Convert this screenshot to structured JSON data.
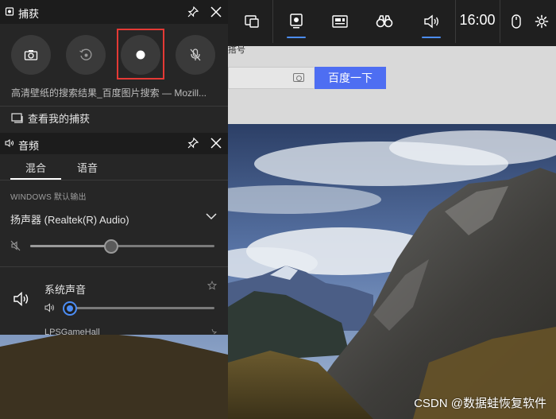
{
  "background": {
    "label_partial": "搭号",
    "search_button": "百度一下",
    "colors": {
      "search_button": "#4e6ef2"
    }
  },
  "gamebar": {
    "clock": "16:00",
    "buttons": [
      {
        "name": "widget-menu",
        "icon": "widget-menu-icon"
      },
      {
        "name": "capture",
        "icon": "capture-icon",
        "active": true
      },
      {
        "name": "performance",
        "icon": "performance-icon"
      },
      {
        "name": "xbox-social",
        "icon": "binoculars-icon"
      },
      {
        "name": "audio",
        "icon": "speaker-icon",
        "active": true
      }
    ],
    "right_icons": [
      "mouse-icon",
      "gear-icon"
    ],
    "accent": "#4c8df5"
  },
  "capture": {
    "title": "捕获",
    "buttons": [
      "screenshot",
      "record-last",
      "start-recording",
      "microphone-off"
    ],
    "current_app": "高清壁纸的搜索结果_百度图片搜索 — Mozill...",
    "gallery_link": "查看我的捕获"
  },
  "audio": {
    "title": "音频",
    "tabs": [
      {
        "label": "混合",
        "active": true
      },
      {
        "label": "语音",
        "active": false
      }
    ],
    "output_heading": "WINDOWS 默认输出",
    "device": "扬声器 (Realtek(R) Audio)",
    "master_volume": 0.44,
    "apps": [
      {
        "name": "系统声音",
        "volume": 0.03
      }
    ],
    "next_app_partial": "LPSGameHall"
  },
  "watermark": "CSDN @数据蛙恢复软件"
}
